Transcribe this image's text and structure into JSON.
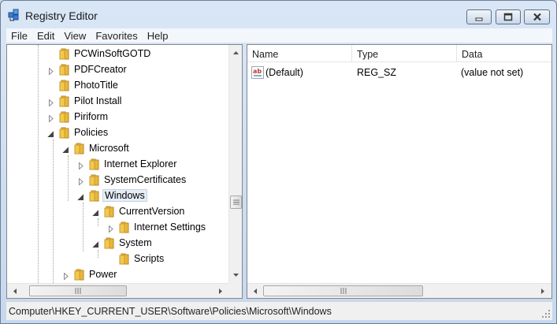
{
  "window": {
    "title": "Registry Editor",
    "icons": {
      "app": "registry-editor-icon",
      "minimize": "minimize-icon",
      "maximize": "maximize-icon",
      "close": "close-icon"
    }
  },
  "menu": [
    "File",
    "Edit",
    "View",
    "Favorites",
    "Help"
  ],
  "tree": {
    "items": [
      {
        "label": "PCWinSoftGOTD",
        "expander": "none",
        "selected": false
      },
      {
        "label": "PDFCreator",
        "expander": "collapsed",
        "selected": false
      },
      {
        "label": "PhotoTitle",
        "expander": "none",
        "selected": false
      },
      {
        "label": "Pilot Install",
        "expander": "collapsed",
        "selected": false
      },
      {
        "label": "Piriform",
        "expander": "collapsed",
        "selected": false
      },
      {
        "label": "Policies",
        "expander": "expanded",
        "selected": false
      },
      {
        "label": "Microsoft",
        "expander": "expanded",
        "selected": false
      },
      {
        "label": "Internet Explorer",
        "expander": "collapsed",
        "selected": false
      },
      {
        "label": "SystemCertificates",
        "expander": "collapsed",
        "selected": false
      },
      {
        "label": "Windows",
        "expander": "expanded",
        "selected": true
      },
      {
        "label": "CurrentVersion",
        "expander": "expanded",
        "selected": false
      },
      {
        "label": "Internet Settings",
        "expander": "collapsed",
        "selected": false
      },
      {
        "label": "System",
        "expander": "expanded",
        "selected": false
      },
      {
        "label": "Scripts",
        "expander": "none",
        "selected": false
      },
      {
        "label": "Power",
        "expander": "collapsed",
        "selected": false
      }
    ]
  },
  "list": {
    "columns": [
      "Name",
      "Type",
      "Data"
    ],
    "rows": [
      {
        "name": "(Default)",
        "type": "REG_SZ",
        "data": "(value not set)",
        "icon": "string-value-icon"
      }
    ]
  },
  "status": {
    "path": "Computer\\HKEY_CURRENT_USER\\Software\\Policies\\Microsoft\\Windows"
  },
  "colors": {
    "folder": "#f2c94c",
    "selection": "#e6edf6",
    "frame": "#c6d8ee"
  }
}
